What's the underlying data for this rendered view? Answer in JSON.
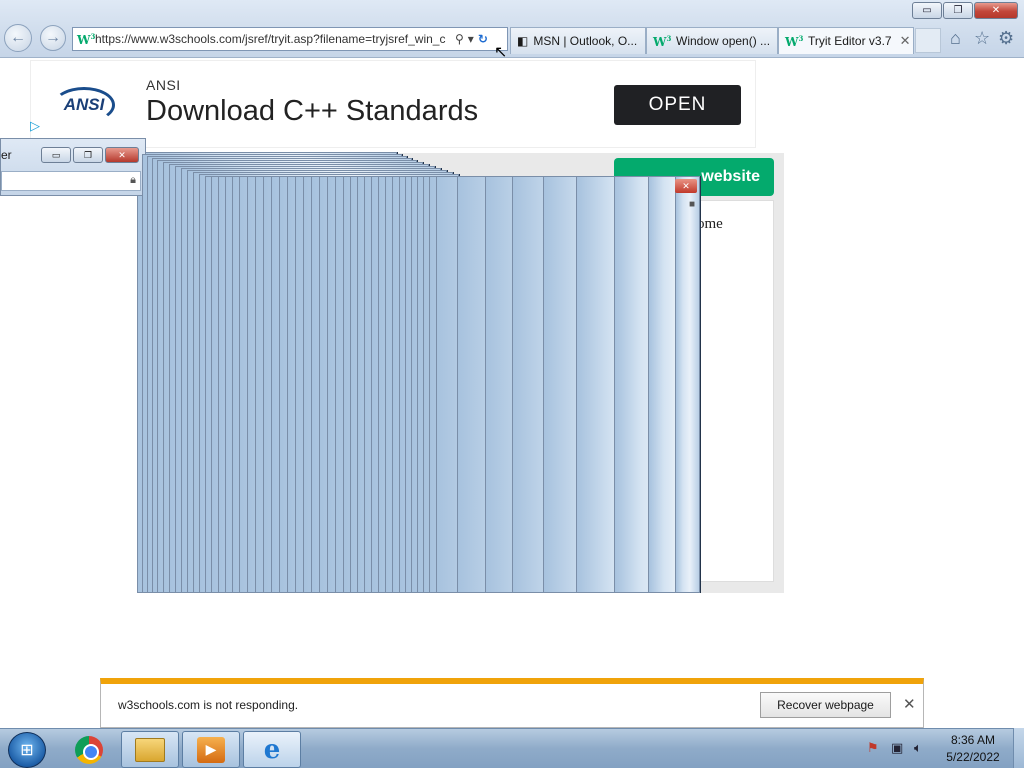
{
  "browser": {
    "address": {
      "url": "https://www.w3schools.com/jsref/tryit.asp?filename=tryjsref_win_c",
      "favicon": "W3"
    },
    "tabs": [
      {
        "label": "MSN | Outlook, O...",
        "icon": "msn-icon"
      },
      {
        "label": "Window open() ...",
        "icon": "w3schools-icon"
      },
      {
        "label": "Tryit Editor v3.7",
        "icon": "w3schools-icon",
        "active": true
      }
    ],
    "window_buttons": {
      "minimize": "▭",
      "maximize": "❐",
      "close": "✕"
    }
  },
  "ad": {
    "logo_text": "ANSI",
    "brand": "ANSI",
    "headline": "Download C++ Standards",
    "cta": "OPEN"
  },
  "page": {
    "right_button_label": "website",
    "result_text": "ome"
  },
  "popup_front": {
    "title_fragment": "er"
  },
  "notification": {
    "message": "w3schools.com is not responding.",
    "button": "Recover webpage",
    "accent_color": "#f0a30a"
  },
  "taskbar": {
    "items": [
      "start-button",
      "chrome",
      "windows-explorer",
      "media-center",
      "internet-explorer"
    ],
    "clock_time": "8:36 AM",
    "clock_date": "5/22/2022"
  },
  "colors": {
    "w3_green": "#04aa6d",
    "ad_button": "#202124",
    "close_red": "#c0392b"
  }
}
